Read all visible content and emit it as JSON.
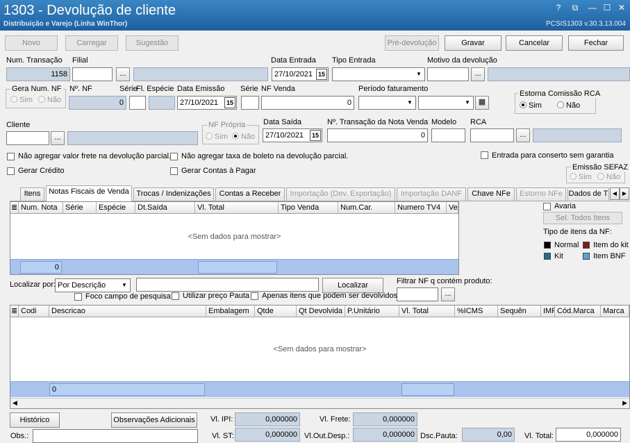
{
  "window": {
    "title": "1303 - Devolução de cliente",
    "subtitle": "Distribuição e Varejo (Linha WinThor)",
    "version": "PCSIS1303  v.30.3.13.004",
    "help_icon": "?",
    "min_icon": "—",
    "max_icon": "☐",
    "close_icon": "✕",
    "restore_icon": "⧉"
  },
  "toolbar": {
    "novo": "Novo",
    "carregar": "Carregar",
    "sugestao": "Sugestão",
    "pre_devolucao": "Pré-devolução",
    "gravar": "Gravar",
    "cancelar": "Cancelar",
    "fechar": "Fechar"
  },
  "form": {
    "num_transacao_label": "Num. Transação",
    "num_transacao": "1158",
    "filial_label": "Filial",
    "ellipsis": "...",
    "data_entrada_label": "Data Entrada",
    "data_entrada": "27/10/2021",
    "tipo_entrada_label": "Tipo Entrada",
    "motivo_label": "Motivo da devolução",
    "gera_num_nf_label": "Gera Num. NF",
    "sim": "Sim",
    "nao": "Não",
    "num_nf_label": "Nº. NF",
    "num_nf": "0",
    "serie_fl_label": "Série",
    "fl_especie_label": "Fl. Espécie",
    "data_emissao_label": "Data Emissão",
    "data_emissao": "27/10/2021",
    "serie_label": "Série",
    "nf_venda_label": "NF Venda",
    "nf_venda": "0",
    "periodo_label": "Período faturamento",
    "estorna_label": "Estorna Comissão RCA",
    "cliente_label": "Cliente",
    "nf_propria_label": "NF Própria",
    "data_saida_label": "Data Saída",
    "data_saida": "27/10/2021",
    "num_transacao_nf_label": "Nº. Transação da Nota Venda",
    "num_transacao_nf": "0",
    "modelo_label": "Modelo",
    "rca_label": "RCA",
    "chk_frete": "Não agregar valor frete na devolução parcial.",
    "chk_boleto": "Não agregar taxa de boleto na devolução parcial.",
    "chk_conserto": "Entrada para conserto sem garantia",
    "chk_credito": "Gerar Crédito",
    "chk_contas": "Gerar Contas à Pagar",
    "emissao_sefaz_label": "Emissão SEFAZ"
  },
  "tabs": [
    "Itens",
    "Notas Fiscais de Venda",
    "Trocas / Indenizações",
    "Contas a Receber",
    "Importação (Dev. Exportação)",
    "Importação DANF",
    "Chave NFe",
    "Estorno NFe",
    "Dados de T"
  ],
  "grid1": {
    "columns": [
      "Num. Nota",
      "Série",
      "Espécie",
      "Dt.Saída",
      "Vl. Total",
      "Tipo Venda",
      "Num.Car.",
      "Numero TV4",
      "Ver"
    ],
    "empty": "<Sem dados para mostrar>",
    "footer_count": "0"
  },
  "side": {
    "avaria": "Avaria",
    "sel_todos": "Sel. Todos Itens",
    "tipo_itens": "Tipo de itens da NF:",
    "normal": "Normal",
    "item_kit": "Item do kit",
    "kit": "Kit",
    "item_bnf": "Item BNF"
  },
  "colors": {
    "normal": "#000000",
    "item_kit": "#7a1f1f",
    "kit": "#1f6f8a",
    "item_bnf": "#5aa0e0"
  },
  "search": {
    "localizar_por_label": "Localizar por:",
    "localizar_por": "Por Descrição",
    "localizar_btn": "Localizar",
    "filtrar_label": "Filtrar NF q contém produto:",
    "foco": "Foco campo de pesquisa",
    "preco_pauta": "Utilizar preço Pauta",
    "apenas": "Apenas itens que podem ser devolvidos"
  },
  "grid2": {
    "columns": [
      "Codi",
      "Descricao",
      "Embalagem",
      "Qtde",
      "Qt Devolvida",
      "P.Unitário",
      "Vl. Total",
      "%ICMS",
      "Sequên",
      "IMF",
      "Cód.Marca",
      "Marca"
    ],
    "empty": "<Sem dados para mostrar>",
    "footer_count": "0"
  },
  "footer": {
    "historico": "Histórico",
    "obs_adicionais": "Observações Adicionais",
    "obs_label": "Obs.:",
    "vl_ipi_label": "Vl. IPI:",
    "vl_ipi": "0,000000",
    "vl_frete_label": "Vl. Frete:",
    "vl_frete": "0,000000",
    "vl_st_label": "Vl. ST:",
    "vl_st": "0,000000",
    "vl_out_label": "Vl.Out.Desp.:",
    "vl_out": "0,000000",
    "dsc_pauta_label": "Dsc.Pauta:",
    "dsc_pauta": "0,00",
    "vl_total_label": "Vl. Total:",
    "vl_total": "0,000000"
  }
}
